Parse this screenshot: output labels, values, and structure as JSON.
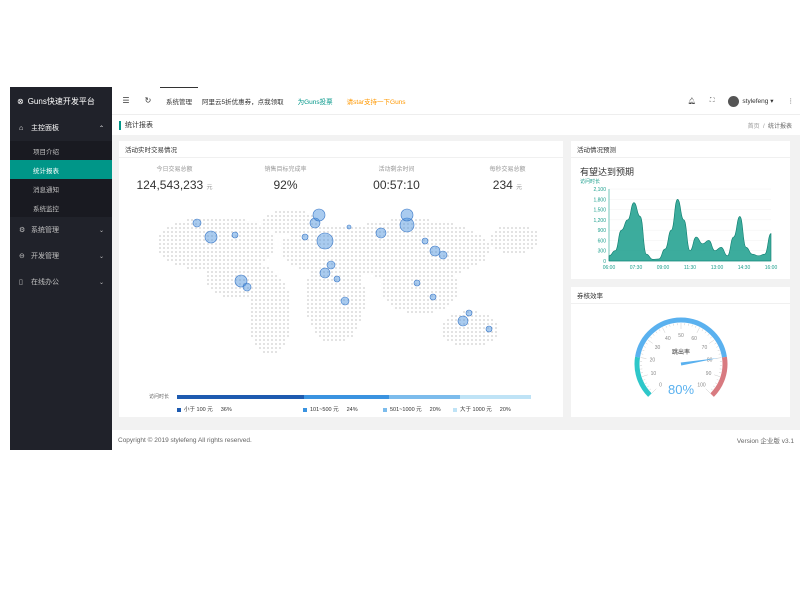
{
  "sidebar": {
    "logo": "Guns快速开发平台",
    "menus": [
      {
        "label": "主控面板",
        "open": true,
        "children": [
          "项目介绍",
          "统计报表",
          "消息通知",
          "系统监控"
        ]
      },
      {
        "label": "系统管理"
      },
      {
        "label": "开发管理"
      },
      {
        "label": "在线办公"
      }
    ]
  },
  "header": {
    "links": [
      "系统管理",
      "阿里云5折优惠券，点我领取",
      "为Guns投票",
      "请star支持一下Guns"
    ],
    "username": "stylefeng"
  },
  "crumbbar": {
    "title": "统计报表",
    "home": "首页",
    "separator": "/",
    "current": "统计报表"
  },
  "realtime": {
    "title": "活动实时交易情况",
    "stats": [
      {
        "label": "今日交易总额",
        "value": "124,543,233",
        "unit": "元"
      },
      {
        "label": "销售目标完成率",
        "value": "92%",
        "unit": ""
      },
      {
        "label": "活动剩余时间",
        "value": "00:57:10",
        "unit": ""
      },
      {
        "label": "每秒交易总额",
        "value": "234",
        "unit": "元"
      }
    ],
    "legend_label": "访问时长",
    "legend": [
      {
        "label": "小于 100 元",
        "pct": "36%",
        "color": "#1e5bb0",
        "fraction": 0.36
      },
      {
        "label": "101~500 元",
        "pct": "24%",
        "color": "#3a93e0",
        "fraction": 0.24
      },
      {
        "label": "501~1000 元",
        "pct": "20%",
        "color": "#7cbcec",
        "fraction": 0.2
      },
      {
        "label": "大于 1000 元",
        "pct": "20%",
        "color": "#bfe3f6",
        "fraction": 0.2
      }
    ]
  },
  "forecast": {
    "title": "活动情况预测",
    "headline": "有望达到预期",
    "ylabel": "访问时长"
  },
  "chart_data": {
    "type": "area",
    "ylabel": "访问时长",
    "y_ticks": [
      "2,100",
      "1,800",
      "1,500",
      "1,200",
      "900",
      "600",
      "300",
      "0"
    ],
    "ylim": [
      0,
      2100
    ],
    "x_ticks": [
      "06:00",
      "07:30",
      "09:00",
      "11:30",
      "13:00",
      "14:30",
      "16:00"
    ],
    "values": [
      150,
      300,
      900,
      1200,
      1700,
      1300,
      200,
      50,
      60,
      350,
      900,
      1800,
      1200,
      300,
      700,
      500,
      600,
      300,
      400,
      150,
      700,
      1300,
      400,
      200,
      150,
      200,
      800
    ],
    "color": "#1a9e8c"
  },
  "gauge": {
    "title": "券核效率",
    "label": "跳出率",
    "value_text": "80%",
    "value": 80,
    "ticks": [
      "0",
      "10",
      "20",
      "30",
      "40",
      "50",
      "60",
      "70",
      "80",
      "90",
      "100"
    ]
  },
  "footer": {
    "copyright": "Copyright © 2019 stylefeng All rights reserved.",
    "version": "Version 企业版 v3.1"
  }
}
